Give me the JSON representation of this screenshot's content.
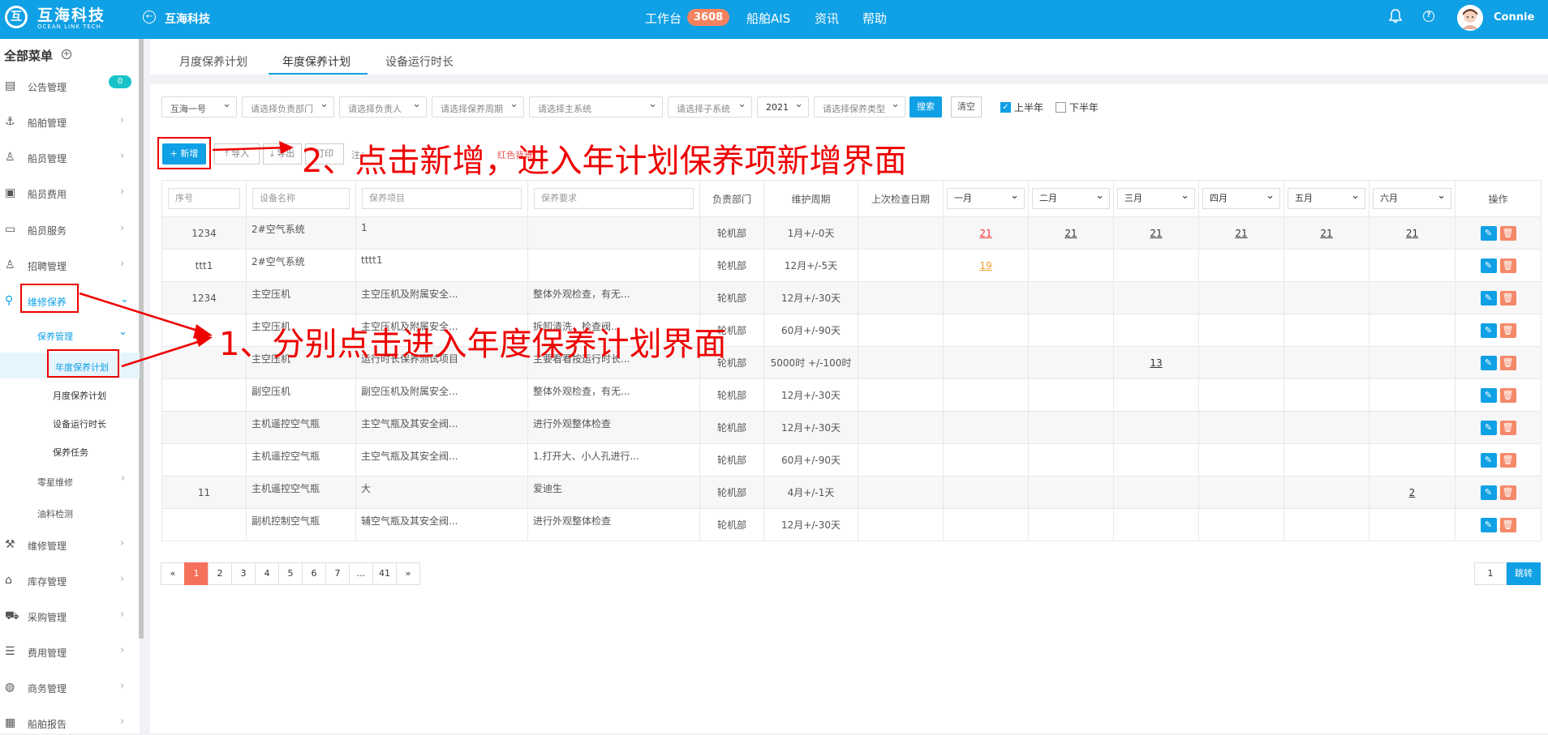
{
  "header": {
    "logo_mark": "互",
    "logo_cn": "互海科技",
    "logo_en": "OCEAN LINK TECH",
    "company": "互海科技",
    "nav": [
      {
        "label": "工作台"
      },
      {
        "label": "船舶AIS"
      },
      {
        "label": "资讯"
      },
      {
        "label": "帮助"
      }
    ],
    "badge": "3608",
    "user": "Connie"
  },
  "sidebar": {
    "title": "全部菜单",
    "badge_zero": "0",
    "items": [
      {
        "label": "公告管理",
        "icon": "notice-icon"
      },
      {
        "label": "船舶管理",
        "icon": "anchor-icon"
      },
      {
        "label": "船员管理",
        "icon": "crew-icon"
      },
      {
        "label": "船员费用",
        "icon": "wallet-icon"
      },
      {
        "label": "船员服务",
        "icon": "monitor-icon"
      },
      {
        "label": "招聘管理",
        "icon": "recruit-icon"
      },
      {
        "label": "维修保养",
        "icon": "wrench-icon"
      }
    ],
    "sub_group": "保养管理",
    "sub_items": [
      "年度保养计划",
      "月度保养计划",
      "设备运行时长",
      "保养任务"
    ],
    "sub_more": [
      "零星维修",
      "油料检测"
    ],
    "bottom_items": [
      {
        "label": "维修管理",
        "icon": "tools-icon"
      },
      {
        "label": "库存管理",
        "icon": "home-icon"
      },
      {
        "label": "采购管理",
        "icon": "cart-icon"
      },
      {
        "label": "费用管理",
        "icon": "coins-icon"
      },
      {
        "label": "商务管理",
        "icon": "globe-icon"
      },
      {
        "label": "船舶报告",
        "icon": "report-icon"
      }
    ]
  },
  "tabs": [
    "月度保养计划",
    "年度保养计划",
    "设备运行时长"
  ],
  "filters": {
    "ship": "互海一号",
    "dept": "请选择负责部门",
    "person": "请选择负责人",
    "cycle": "请选择保养周期",
    "main_sys": "请选择主系统",
    "sub_sys": "请选择子系统",
    "year": "2021",
    "type": "请选择保养类型",
    "search": "搜索",
    "clear": "清空",
    "first_half": "上半年",
    "second_half": "下半年"
  },
  "toolbar": {
    "add": "+ 新增",
    "import": "导入",
    "export": "导出",
    "print": "打印",
    "note": "注：",
    "note_red": "红色背景"
  },
  "table": {
    "headers": {
      "no": "序号",
      "equip": "设备名称",
      "item": "保养项目",
      "req": "保养要求",
      "dept": "负责部门",
      "cycle": "维护周期",
      "last": "上次检查日期",
      "months": [
        "一月",
        "二月",
        "三月",
        "四月",
        "五月",
        "六月"
      ],
      "op": "操作"
    },
    "rows": [
      {
        "no": "1234",
        "equip": "2#空气系统",
        "item": "1",
        "req": "",
        "dept": "轮机部",
        "cycle": "1月+/-0天",
        "m": [
          "21",
          "21",
          "21",
          "21",
          "21",
          "21"
        ]
      },
      {
        "no": "ttt1",
        "equip": "2#空气系统",
        "item": "tttt1",
        "req": "",
        "dept": "轮机部",
        "cycle": "12月+/-5天",
        "m": [
          "19",
          "",
          "",
          "",
          "",
          ""
        ]
      },
      {
        "no": "1234",
        "equip": "主空压机",
        "item": "主空压机及附属安全...",
        "req": "整体外观检查，有无...",
        "dept": "轮机部",
        "cycle": "12月+/-30天",
        "m": [
          "",
          "",
          "",
          "",
          "",
          ""
        ]
      },
      {
        "no": "",
        "equip": "主空压机",
        "item": "主空压机及附属安全...",
        "req": "拆卸清洗，检查阀...",
        "dept": "轮机部",
        "cycle": "60月+/-90天",
        "m": [
          "",
          "",
          "",
          "",
          "",
          ""
        ]
      },
      {
        "no": "",
        "equip": "主空压机",
        "item": "运行时长保养测试项目",
        "req": "主要看看按运行时长...",
        "dept": "轮机部",
        "cycle": "5000时 +/-100时",
        "m": [
          "",
          "",
          "13",
          "",
          "",
          ""
        ]
      },
      {
        "no": "",
        "equip": "副空压机",
        "item": "副空压机及附属安全...",
        "req": "整体外观检查，有无...",
        "dept": "轮机部",
        "cycle": "12月+/-30天",
        "m": [
          "",
          "",
          "",
          "",
          "",
          ""
        ]
      },
      {
        "no": "",
        "equip": "主机遥控空气瓶",
        "item": "主空气瓶及其安全阀...",
        "req": "进行外观整体检查",
        "dept": "轮机部",
        "cycle": "12月+/-30天",
        "m": [
          "",
          "",
          "",
          "",
          "",
          ""
        ]
      },
      {
        "no": "",
        "equip": "主机遥控空气瓶",
        "item": "主空气瓶及其安全阀...",
        "req": "1.打开大、小人孔进行...",
        "dept": "轮机部",
        "cycle": "60月+/-90天",
        "m": [
          "",
          "",
          "",
          "",
          "",
          ""
        ]
      },
      {
        "no": "11",
        "equip": "主机遥控空气瓶",
        "item": "大",
        "req": "爱迪生",
        "dept": "轮机部",
        "cycle": "4月+/-1天",
        "m": [
          "",
          "",
          "",
          "",
          "",
          "2"
        ]
      },
      {
        "no": "",
        "equip": "副机控制空气瓶",
        "item": "辅空气瓶及其安全阀...",
        "req": "进行外观整体检查",
        "dept": "轮机部",
        "cycle": "12月+/-30天",
        "m": [
          "",
          "",
          "",
          "",
          "",
          ""
        ]
      }
    ]
  },
  "pagination": {
    "prev": "«",
    "pages": [
      "1",
      "2",
      "3",
      "4",
      "5",
      "6",
      "7",
      "...",
      "41"
    ],
    "next": "»",
    "current": "1",
    "jump": "跳转"
  },
  "annotations": {
    "step1": "1、分别点击进入年度保养计划界面",
    "step2": "2、点击新增，进入年计划保养项新增界面"
  },
  "colors": {
    "brand": "#0fa0e5",
    "badge": "#f5825e",
    "annotation": "#e00000"
  }
}
